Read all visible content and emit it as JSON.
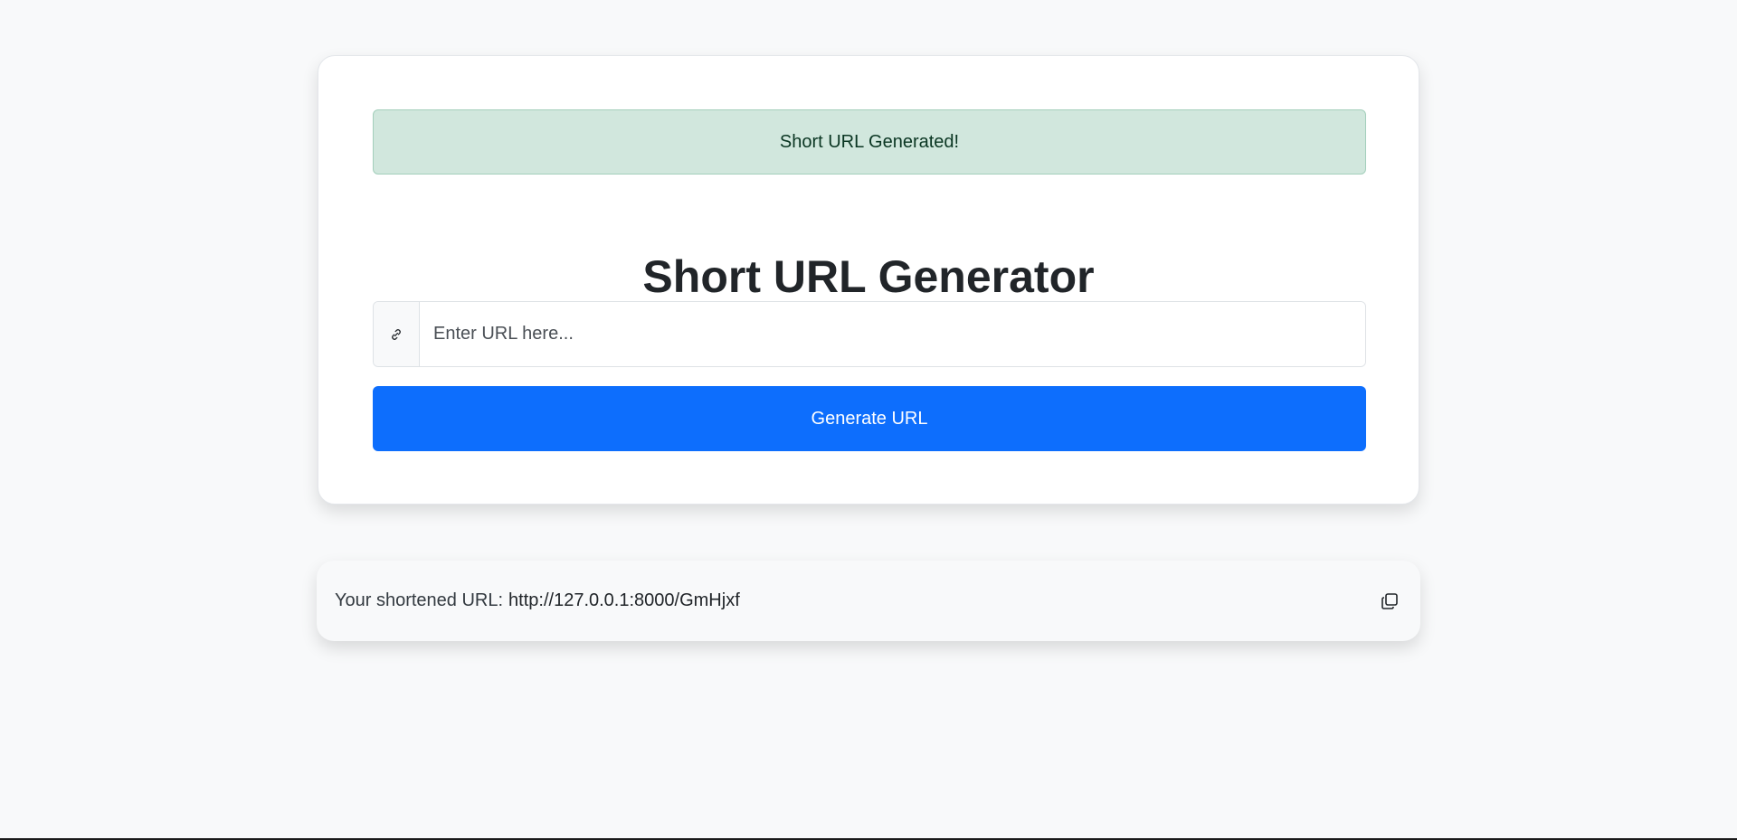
{
  "alert": {
    "message": "Short URL Generated!"
  },
  "header": {
    "title": "Short URL Generator"
  },
  "form": {
    "input_placeholder": "Enter URL here...",
    "input_value": "",
    "addon_icon": "link-icon",
    "button_label": "Generate URL"
  },
  "result": {
    "label": "Your shortened URL:",
    "url": "http://127.0.0.1:8000/GmHjxf",
    "copy_icon": "copy-icon"
  },
  "colors": {
    "page_background": "#f8f9fa",
    "primary": "#0d6efd",
    "success_bg": "#d1e7dd",
    "success_text": "#0a3622"
  }
}
